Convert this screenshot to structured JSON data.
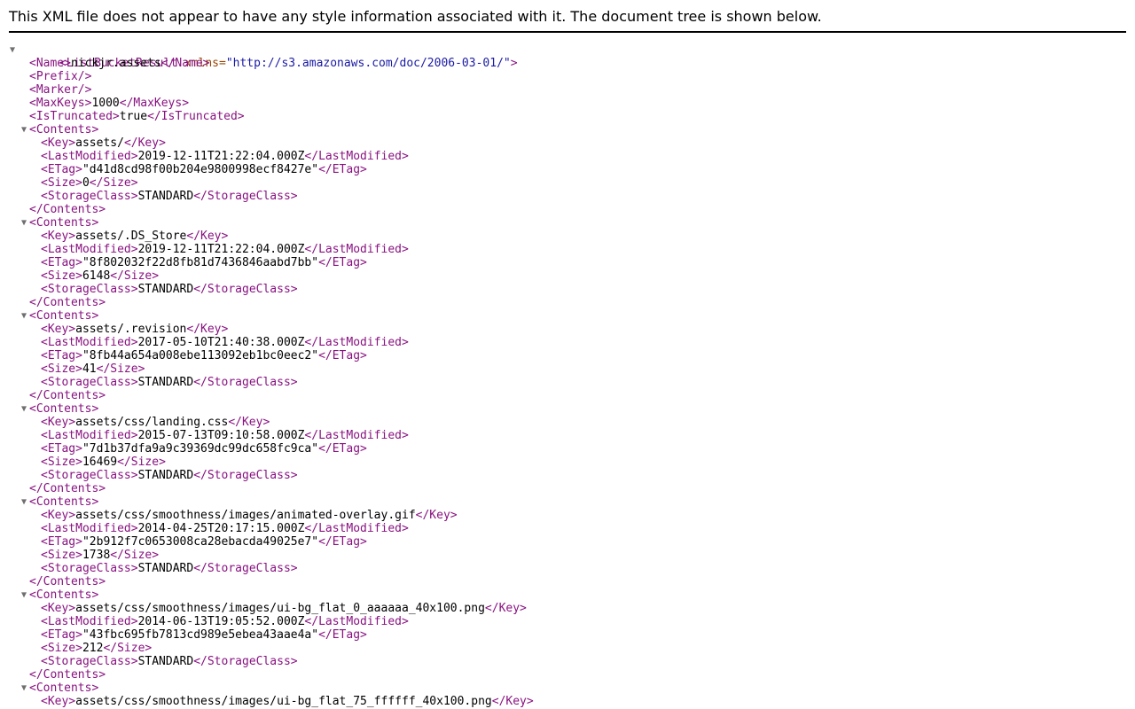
{
  "notice": "This XML file does not appear to have any style information associated with it. The document tree is shown below.",
  "toggle_glyph": "▼",
  "root": {
    "open": "<ListBucketResult",
    "attr_name": "xmlns=",
    "attr_value": "\"http://s3.amazonaws.com/doc/2006-03-01/\"",
    "open_end": ">"
  },
  "header_fields": [
    {
      "open": "<Name>",
      "value": "nickjr.assets",
      "close": "</Name>"
    },
    {
      "open": "<Prefix/>",
      "value": "",
      "close": ""
    },
    {
      "open": "<Marker/>",
      "value": "",
      "close": ""
    },
    {
      "open": "<MaxKeys>",
      "value": "1000",
      "close": "</MaxKeys>"
    },
    {
      "open": "<IsTruncated>",
      "value": "true",
      "close": "</IsTruncated>"
    }
  ],
  "contents_open": "<Contents>",
  "contents_close": "</Contents>",
  "tags": {
    "key_open": "<Key>",
    "key_close": "</Key>",
    "lm_open": "<LastModified>",
    "lm_close": "</LastModified>",
    "etag_open": "<ETag>",
    "etag_close": "</ETag>",
    "size_open": "<Size>",
    "size_close": "</Size>",
    "sc_open": "<StorageClass>",
    "sc_close": "</StorageClass>"
  },
  "contents": [
    {
      "key": "assets/",
      "last_modified": "2019-12-11T21:22:04.000Z",
      "etag": "\"d41d8cd98f00b204e9800998ecf8427e\"",
      "size": "0",
      "storage_class": "STANDARD"
    },
    {
      "key": "assets/.DS_Store",
      "last_modified": "2019-12-11T21:22:04.000Z",
      "etag": "\"8f802032f22d8fb81d7436846aabd7bb\"",
      "size": "6148",
      "storage_class": "STANDARD"
    },
    {
      "key": "assets/.revision",
      "last_modified": "2017-05-10T21:40:38.000Z",
      "etag": "\"8fb44a654a008ebe113092eb1bc0eec2\"",
      "size": "41",
      "storage_class": "STANDARD"
    },
    {
      "key": "assets/css/landing.css",
      "last_modified": "2015-07-13T09:10:58.000Z",
      "etag": "\"7d1b37dfa9a9c39369dc99dc658fc9ca\"",
      "size": "16469",
      "storage_class": "STANDARD"
    },
    {
      "key": "assets/css/smoothness/images/animated-overlay.gif",
      "last_modified": "2014-04-25T20:17:15.000Z",
      "etag": "\"2b912f7c0653008ca28ebacda49025e7\"",
      "size": "1738",
      "storage_class": "STANDARD"
    },
    {
      "key": "assets/css/smoothness/images/ui-bg_flat_0_aaaaaa_40x100.png",
      "last_modified": "2014-06-13T19:05:52.000Z",
      "etag": "\"43fbc695fb7813cd989e5ebea43aae4a\"",
      "size": "212",
      "storage_class": "STANDARD"
    }
  ],
  "partial_content": {
    "key": "assets/css/smoothness/images/ui-bg_flat_75_ffffff_40x100.png"
  }
}
